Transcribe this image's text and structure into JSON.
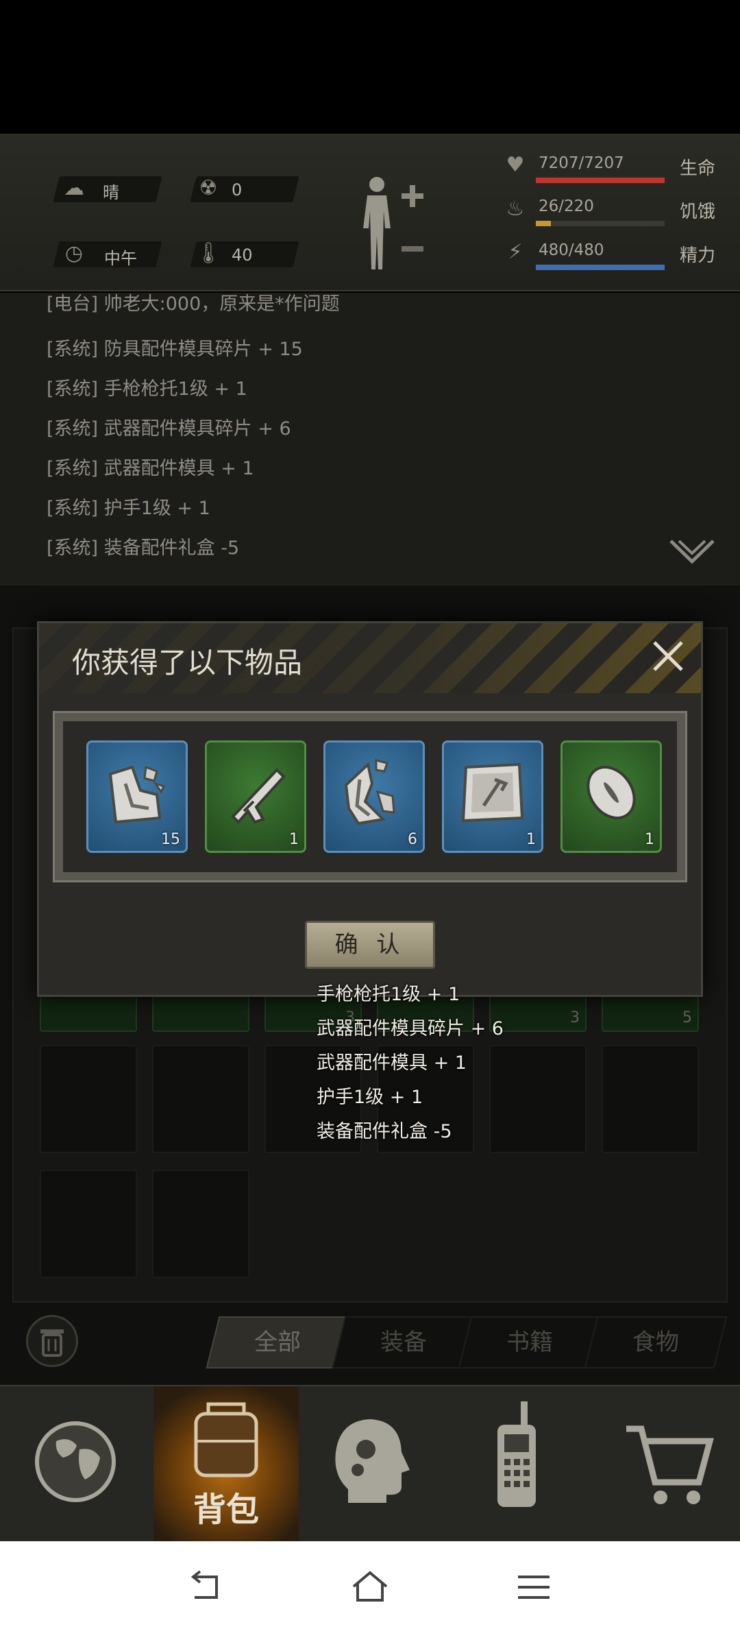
{
  "status": {
    "weather": "晴",
    "radiation": "0",
    "time_of_day": "中午",
    "temperature": "40",
    "vitals": [
      {
        "value": "7207/7207",
        "label": "生命",
        "fill": 1.0,
        "color": "#c0352c"
      },
      {
        "value": "26/220",
        "label": "饥饿",
        "fill": 0.118,
        "color": "#c8962e"
      },
      {
        "value": "480/480",
        "label": "精力",
        "fill": 1.0,
        "color": "#3f6fb5"
      }
    ]
  },
  "log": {
    "lines": [
      "[电台] 帅老大:000，原来是*作问题",
      "[系统] 防具配件模具碎片 + 15",
      "[系统] 手枪枪托1级 + 1",
      "[系统] 武器配件模具碎片 + 6",
      "[系统] 武器配件模具 + 1",
      "[系统] 护手1级 + 1",
      "[系统] 装备配件礼盒 -5"
    ]
  },
  "inventory": {
    "partial_counts": [
      "3",
      "3",
      "5"
    ]
  },
  "tabs": [
    "全部",
    "装备",
    "书籍",
    "食物"
  ],
  "nav": {
    "backpack_label": "背包"
  },
  "dialog": {
    "title": "你获得了以下物品",
    "confirm_label": "确 认",
    "items": [
      {
        "icon": "armor-mold-fragment-icon",
        "rarity": "blue",
        "count": "15"
      },
      {
        "icon": "pistol-stock-icon",
        "rarity": "green",
        "count": "1"
      },
      {
        "icon": "weapon-mold-fragment-icon",
        "rarity": "blue",
        "count": "6"
      },
      {
        "icon": "weapon-mold-icon",
        "rarity": "blue",
        "count": "1"
      },
      {
        "icon": "handguard-icon",
        "rarity": "green",
        "count": "1"
      }
    ]
  },
  "toasts": [
    "手枪枪托1级 + 1",
    "武器配件模具碎片 + 6",
    "武器配件模具 + 1",
    "护手1级 + 1",
    "装备配件礼盒 -5"
  ]
}
